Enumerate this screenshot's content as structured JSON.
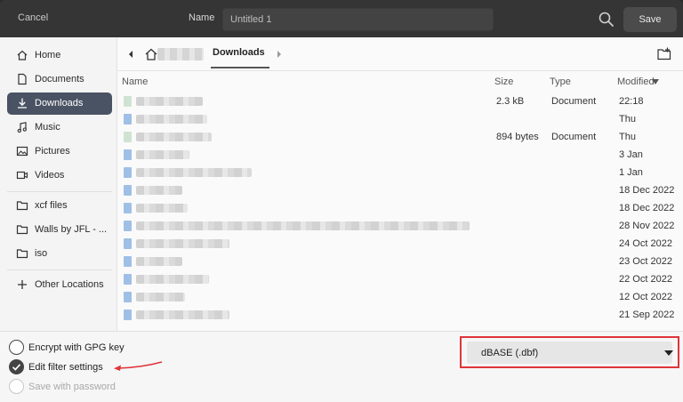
{
  "header": {
    "cancel_label": "Cancel",
    "name_label": "Name",
    "name_value": "Untitled 1",
    "save_label": "Save"
  },
  "sidebar": {
    "items": [
      {
        "label": "Home",
        "icon": "home-icon"
      },
      {
        "label": "Documents",
        "icon": "document-icon"
      },
      {
        "label": "Downloads",
        "icon": "download-icon",
        "active": true
      },
      {
        "label": "Music",
        "icon": "music-icon"
      },
      {
        "label": "Pictures",
        "icon": "picture-icon"
      },
      {
        "label": "Videos",
        "icon": "video-icon"
      },
      {
        "label": "xcf files",
        "icon": "folder-icon"
      },
      {
        "label": "Walls by JFL - ...",
        "icon": "folder-icon"
      },
      {
        "label": "iso",
        "icon": "folder-icon"
      },
      {
        "label": "Other Locations",
        "icon": "plus-icon"
      }
    ]
  },
  "pathbar": {
    "current": "Downloads"
  },
  "filelist": {
    "columns": {
      "name": "Name",
      "size": "Size",
      "type": "Type",
      "modified": "Modified"
    },
    "rows": [
      {
        "size": "2.3 kB",
        "type": "Document",
        "modified": "22:18"
      },
      {
        "size": "",
        "type": "",
        "modified": "Thu"
      },
      {
        "size": "894 bytes",
        "type": "Document",
        "modified": "Thu"
      },
      {
        "size": "",
        "type": "",
        "modified": "3 Jan"
      },
      {
        "size": "",
        "type": "",
        "modified": "1 Jan"
      },
      {
        "size": "",
        "type": "",
        "modified": "18 Dec 2022"
      },
      {
        "size": "",
        "type": "",
        "modified": "18 Dec 2022"
      },
      {
        "size": "",
        "type": "",
        "modified": "28 Nov 2022"
      },
      {
        "size": "",
        "type": "",
        "modified": "24 Oct 2022"
      },
      {
        "size": "",
        "type": "",
        "modified": "23 Oct 2022"
      },
      {
        "size": "",
        "type": "",
        "modified": "22 Oct 2022"
      },
      {
        "size": "",
        "type": "",
        "modified": "12 Oct 2022"
      },
      {
        "size": "",
        "type": "",
        "modified": "21 Sep 2022"
      }
    ]
  },
  "options": {
    "encrypt_label": "Encrypt with GPG key",
    "encrypt_checked": false,
    "filter_label": "Edit filter settings",
    "filter_checked": true,
    "password_label": "Save with password",
    "password_enabled": false
  },
  "file_type": {
    "selected": "dBASE (.dbf)"
  },
  "colors": {
    "accent_selected": "#4a5363",
    "highlight_box": "#e0343a",
    "annotation_arrow": "#e0343a"
  }
}
